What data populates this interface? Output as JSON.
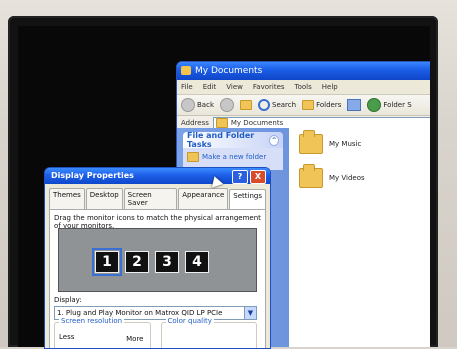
{
  "explorer": {
    "title": "My Documents",
    "menu": [
      "File",
      "Edit",
      "View",
      "Favorites",
      "Tools",
      "Help"
    ],
    "toolbar": {
      "back": "Back",
      "search": "Search",
      "folders": "Folders",
      "folder_sync": "Folder S"
    },
    "address": {
      "label": "Address",
      "value": "My Documents"
    },
    "task_pane": {
      "title": "File and Folder Tasks",
      "link": "Make a new folder"
    },
    "files": [
      {
        "name": "My Music"
      },
      {
        "name": "My Videos"
      }
    ]
  },
  "display_properties": {
    "title": "Display Properties",
    "tabs": [
      "Themes",
      "Desktop",
      "Screen Saver",
      "Appearance",
      "Settings"
    ],
    "active_tab": "Settings",
    "instruction": "Drag the monitor icons to match the physical arrangement of your monitors.",
    "monitors": [
      "1",
      "2",
      "3",
      "4"
    ],
    "display_label": "Display:",
    "display_value": "1. Plug and Play Monitor on Matrox QID LP PCIe",
    "screen_resolution": {
      "label": "Screen resolution",
      "less": "Less",
      "more": "More"
    },
    "color_quality": {
      "label": "Color quality"
    },
    "help_button": "?",
    "close_button": "X"
  }
}
